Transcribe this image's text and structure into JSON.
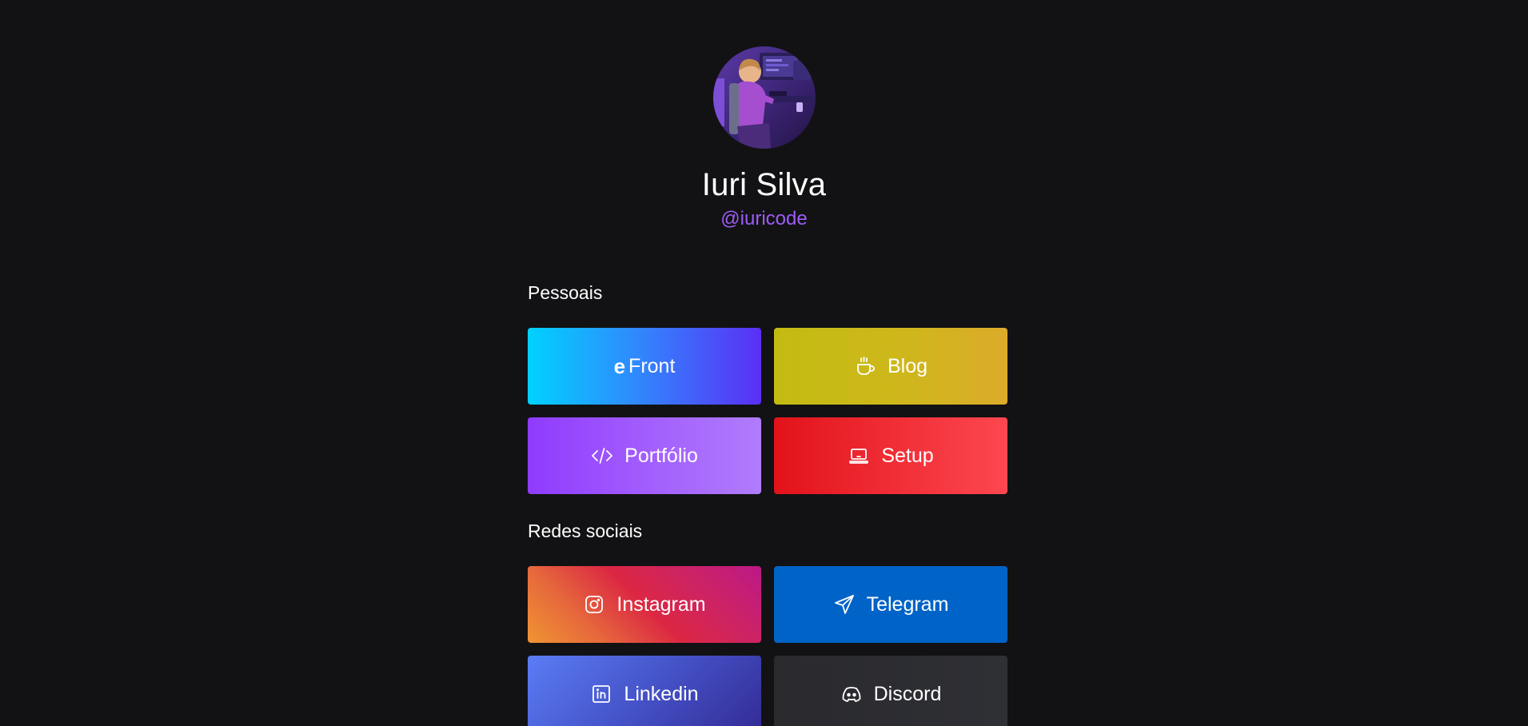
{
  "profile": {
    "name": "Iuri Silva",
    "handle": "@iuricode"
  },
  "sections": {
    "personal_title": "Pessoais",
    "social_title": "Redes sociais"
  },
  "personal_links": {
    "efront": {
      "mark": "e",
      "label": "Front",
      "icon": "efront-logo-icon",
      "colors": [
        "#00d2ff",
        "#5a2ff5"
      ]
    },
    "blog": {
      "label": "Blog",
      "icon": "coffee-cup-icon",
      "colors": [
        "#c3bb12",
        "#dcab2a"
      ]
    },
    "portfolio": {
      "label": "Portfólio",
      "icon": "code-icon",
      "colors": [
        "#8f3bfd",
        "#b07cfd"
      ]
    },
    "setup": {
      "label": "Setup",
      "icon": "laptop-icon",
      "colors": [
        "#e2121a",
        "#fd4750"
      ]
    }
  },
  "social_links": {
    "instagram": {
      "label": "Instagram",
      "icon": "instagram-icon",
      "colors": [
        "#f09433",
        "#dc2743",
        "#bc1888"
      ]
    },
    "telegram": {
      "label": "Telegram",
      "icon": "paper-plane-icon",
      "colors": [
        "#0063c7"
      ]
    },
    "linkedin": {
      "label": "Linkedin",
      "icon": "linkedin-icon",
      "colors": [
        "#5b7cf5",
        "#332b95"
      ]
    },
    "discord": {
      "label": "Discord",
      "icon": "discord-icon",
      "colors": [
        "#2b2d31",
        "#2f3035"
      ]
    }
  },
  "colors": {
    "background": "#121214",
    "accent": "#9d5cf6"
  }
}
